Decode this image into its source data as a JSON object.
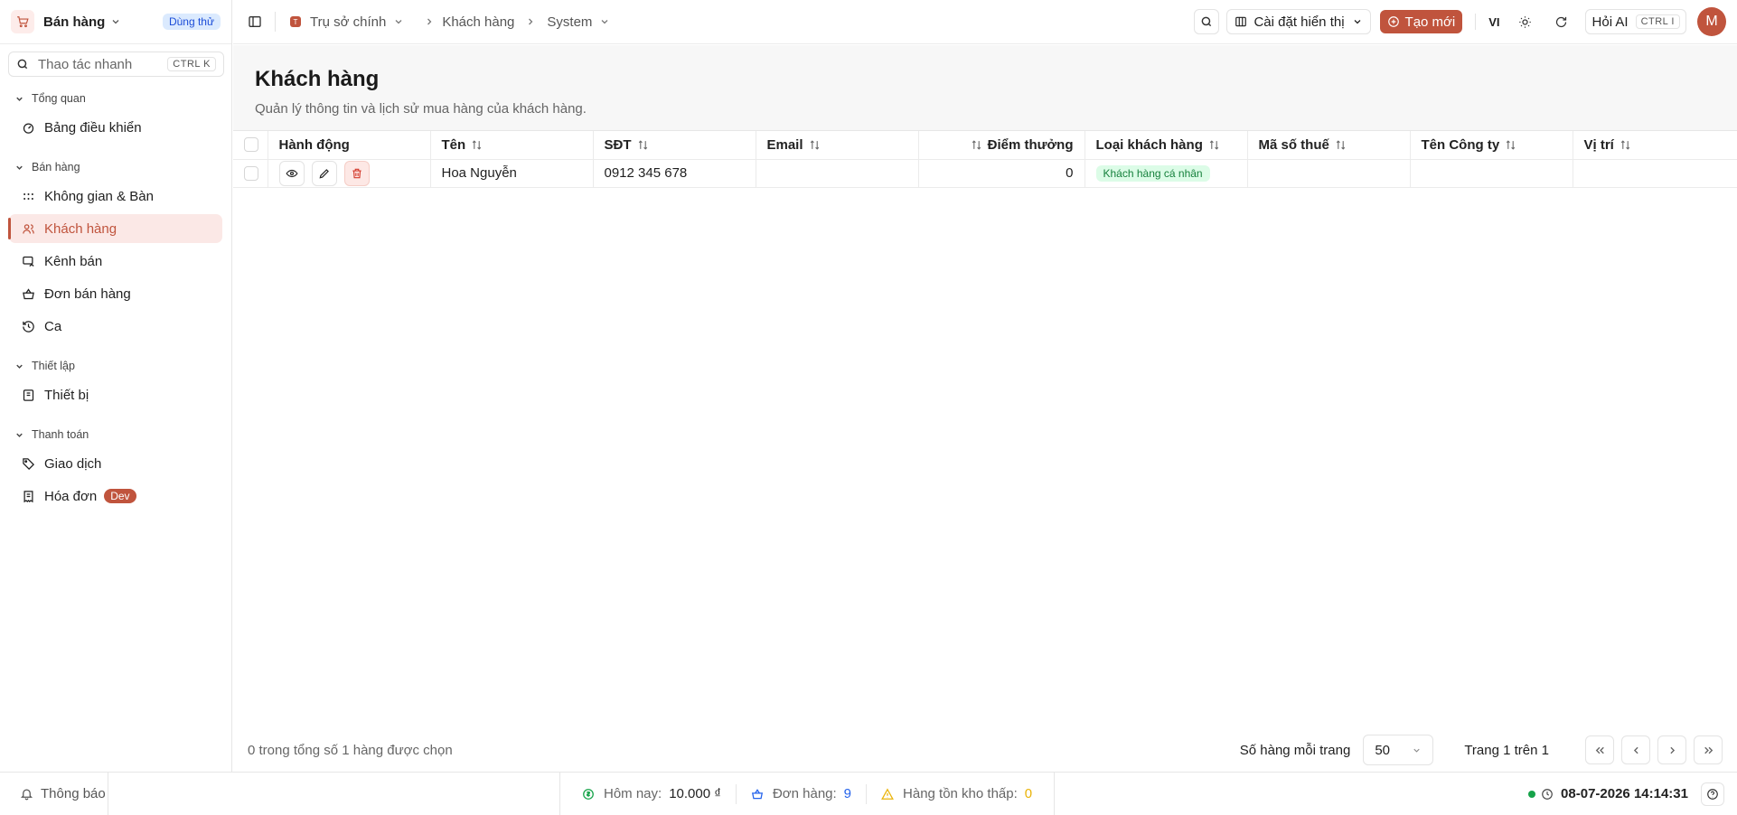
{
  "app": {
    "name": "Bán hàng",
    "trial_badge": "Dùng thử"
  },
  "search": {
    "placeholder": "Thao tác nhanh",
    "shortcut": "CTRL K"
  },
  "sidebar": {
    "groups": [
      {
        "title": "Tổng quan",
        "items": [
          {
            "label": "Bảng điều khiển",
            "icon": "gauge-icon"
          }
        ]
      },
      {
        "title": "Bán hàng",
        "items": [
          {
            "label": "Không gian & Bàn",
            "icon": "grid-dots-icon"
          },
          {
            "label": "Khách hàng",
            "icon": "users-icon",
            "active": true
          },
          {
            "label": "Kênh bán",
            "icon": "channel-icon"
          },
          {
            "label": "Đơn bán hàng",
            "icon": "basket-icon"
          },
          {
            "label": "Ca",
            "icon": "history-icon"
          }
        ]
      },
      {
        "title": "Thiết lập",
        "items": [
          {
            "label": "Thiết bị",
            "icon": "device-icon"
          }
        ]
      },
      {
        "title": "Thanh toán",
        "items": [
          {
            "label": "Giao dịch",
            "icon": "tag-icon"
          },
          {
            "label": "Hóa đơn",
            "icon": "receipt-icon",
            "badge": "Dev"
          }
        ]
      }
    ]
  },
  "topbar": {
    "breadcrumbs": [
      "Trụ sở chính",
      "Khách hàng",
      "System"
    ],
    "display_settings": "Cài đặt hiển thị",
    "create_label": "Tạo mới",
    "language": "VI",
    "ask_ai": "Hỏi AI",
    "ask_ai_shortcut": "CTRL I",
    "avatar_initial": "M"
  },
  "page": {
    "title": "Khách hàng",
    "subtitle": "Quản lý thông tin và lịch sử mua hàng của khách hàng."
  },
  "table": {
    "columns": [
      "Hành động",
      "Tên",
      "SĐT",
      "Email",
      "Điểm thưởng",
      "Loại khách hàng",
      "Mã số thuế",
      "Tên Công ty",
      "Vị trí"
    ],
    "rows": [
      {
        "name": "Hoa Nguyễn",
        "phone": "0912 345 678",
        "email": "",
        "points": "0",
        "type": "Khách hàng cá nhân",
        "tax_code": "",
        "company": "",
        "position": ""
      }
    ]
  },
  "pagination": {
    "selection_text": "0 trong tổng số 1 hàng được chọn",
    "rows_per_page_label": "Số hàng mỗi trang",
    "rows_per_page": "50",
    "page_info": "Trang 1 trên 1"
  },
  "statusbar": {
    "notifications": "Thông báo",
    "today_label": "Hôm nay:",
    "today_value": "10.000 ₫",
    "orders_label": "Đơn hàng:",
    "orders_value": "9",
    "low_stock_label": "Hàng tồn kho thấp:",
    "low_stock_value": "0",
    "datetime": "08-07-2026 14:14:31"
  },
  "colors": {
    "accent": "#c0543d",
    "active_bg": "#fbe8e6",
    "success": "#16a34a",
    "info": "#1d4ed8",
    "warning": "#eab308"
  }
}
